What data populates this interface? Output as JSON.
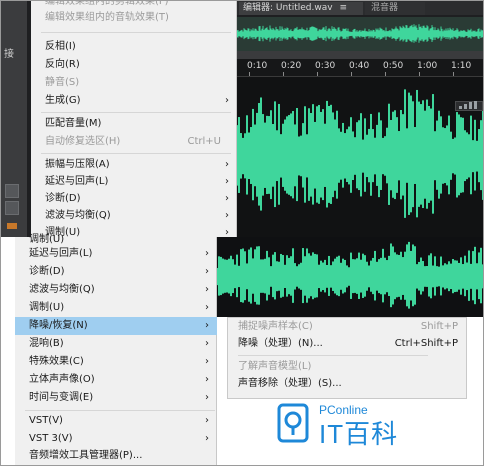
{
  "editor": {
    "panel_tab_fragment": "接",
    "tab_active": "编辑器: Untitled.wav",
    "tab_active_tail": "≡",
    "tab_second": "混音器",
    "ruler_ticks": [
      "0:10",
      "0:20",
      "0:30",
      "0:40",
      "0:50",
      "1:00",
      "1:10"
    ]
  },
  "menu_top": {
    "items": [
      {
        "label": "编辑效果组内的剪辑效果(F)",
        "shortcut": "",
        "disabled": true,
        "submenu": false
      },
      {
        "label": "编辑效果组内的音轨效果(T)",
        "shortcut": "",
        "disabled": true,
        "submenu": false
      },
      {
        "label": "反相(I)",
        "shortcut": "",
        "disabled": false,
        "submenu": false
      },
      {
        "label": "反向(R)",
        "shortcut": "",
        "disabled": false,
        "submenu": false
      },
      {
        "label": "静音(S)",
        "shortcut": "",
        "disabled": true,
        "submenu": false
      },
      {
        "label": "生成(G)",
        "shortcut": "",
        "disabled": false,
        "submenu": true
      },
      {
        "label": "匹配音量(M)",
        "shortcut": "",
        "disabled": false,
        "submenu": false
      },
      {
        "label": "自动修复选区(H)",
        "shortcut": "Ctrl+U",
        "disabled": true,
        "submenu": false
      },
      {
        "label": "振幅与压限(A)",
        "shortcut": "",
        "disabled": false,
        "submenu": true
      },
      {
        "label": "延迟与回声(L)",
        "shortcut": "",
        "disabled": false,
        "submenu": true
      },
      {
        "label": "诊断(D)",
        "shortcut": "",
        "disabled": false,
        "submenu": true
      },
      {
        "label": "滤波与均衡(Q)",
        "shortcut": "",
        "disabled": false,
        "submenu": true
      },
      {
        "label": "调制(U)",
        "shortcut": "",
        "disabled": false,
        "submenu": true
      }
    ]
  },
  "menu_bottom": {
    "items": [
      {
        "label": "延迟与回声(L)",
        "highlight": false
      },
      {
        "label": "诊断(D)",
        "highlight": false
      },
      {
        "label": "滤波与均衡(Q)",
        "highlight": false
      },
      {
        "label": "调制(U)",
        "highlight": false
      },
      {
        "label": "降噪/恢复(N)",
        "highlight": true
      },
      {
        "label": "混响(B)",
        "highlight": false
      },
      {
        "label": "特殊效果(C)",
        "highlight": false
      },
      {
        "label": "立体声声像(O)",
        "highlight": false
      },
      {
        "label": "时间与变调(E)",
        "highlight": false
      },
      {
        "label": "VST(V)",
        "highlight": false
      },
      {
        "label": "VST 3(V)",
        "highlight": false
      },
      {
        "label": "音频增效工具管理器(P)...",
        "highlight": false
      }
    ],
    "arrow": "›"
  },
  "submenu": {
    "items": [
      {
        "label": "捕捉噪声样本(C)",
        "shortcut": "Shift+P",
        "disabled": true
      },
      {
        "label": "降噪（处理）(N)...",
        "shortcut": "Ctrl+Shift+P",
        "disabled": false
      },
      {
        "label": "了解声音模型(L)",
        "shortcut": "",
        "disabled": true
      },
      {
        "label": "声音移除（处理）(S)...",
        "shortcut": "",
        "disabled": false
      }
    ]
  },
  "watermark": {
    "site": "PConline",
    "brand": "IT百科",
    "color": "#1e88d8"
  },
  "colors": {
    "waveform": "#3fd69c",
    "menu_bg": "#f0f0f0",
    "highlight": "#9fcef0",
    "editor_bg": "#111213"
  }
}
